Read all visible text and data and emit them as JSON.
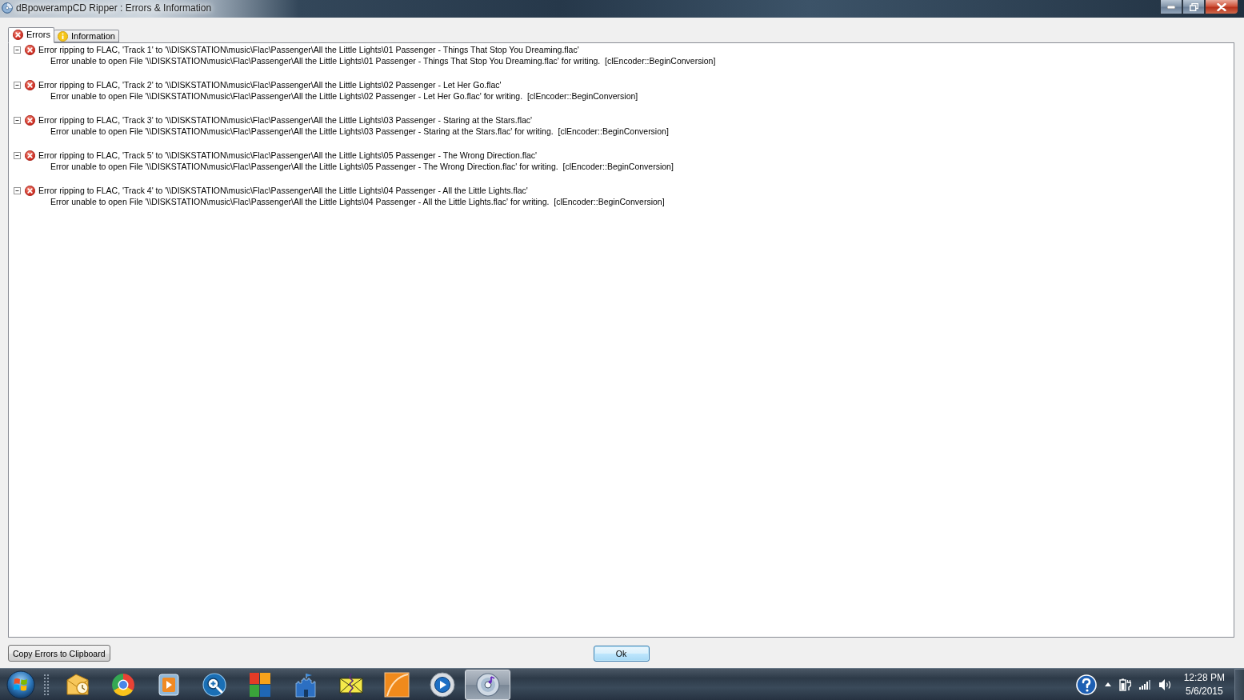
{
  "window": {
    "title": "dBpowerampCD Ripper : Errors & Information"
  },
  "tabs": [
    {
      "label": "Errors",
      "kind": "error",
      "selected": true
    },
    {
      "label": "Information",
      "kind": "info",
      "selected": false
    }
  ],
  "log": {
    "entries": [
      {
        "text": "Error ripping to FLAC, 'Track 1' to '\\\\DISKSTATION\\music\\Flac\\Passenger\\All the Little Lights\\01 Passenger - Things That Stop You Dreaming.flac'",
        "expanded": true,
        "children": [
          {
            "text": "Error unable to open File '\\\\DISKSTATION\\music\\Flac\\Passenger\\All the Little Lights\\01 Passenger - Things That Stop You Dreaming.flac' for writing.  [clEncoder::BeginConversion]"
          }
        ]
      },
      {
        "text": "Error ripping to FLAC, 'Track 2' to '\\\\DISKSTATION\\music\\Flac\\Passenger\\All the Little Lights\\02 Passenger - Let Her Go.flac'",
        "expanded": true,
        "children": [
          {
            "text": "Error unable to open File '\\\\DISKSTATION\\music\\Flac\\Passenger\\All the Little Lights\\02 Passenger - Let Her Go.flac' for writing.  [clEncoder::BeginConversion]"
          }
        ]
      },
      {
        "text": "Error ripping to FLAC, 'Track 3' to '\\\\DISKSTATION\\music\\Flac\\Passenger\\All the Little Lights\\03 Passenger - Staring at the Stars.flac'",
        "expanded": true,
        "children": [
          {
            "text": "Error unable to open File '\\\\DISKSTATION\\music\\Flac\\Passenger\\All the Little Lights\\03 Passenger - Staring at the Stars.flac' for writing.  [clEncoder::BeginConversion]"
          }
        ]
      },
      {
        "text": "Error ripping to FLAC, 'Track 5' to '\\\\DISKSTATION\\music\\Flac\\Passenger\\All the Little Lights\\05 Passenger - The Wrong Direction.flac'",
        "expanded": true,
        "children": [
          {
            "text": "Error unable to open File '\\\\DISKSTATION\\music\\Flac\\Passenger\\All the Little Lights\\05 Passenger - The Wrong Direction.flac' for writing.  [clEncoder::BeginConversion]"
          }
        ]
      },
      {
        "text": "Error ripping to FLAC, 'Track 4' to '\\\\DISKSTATION\\music\\Flac\\Passenger\\All the Little Lights\\04 Passenger - All the Little Lights.flac'",
        "expanded": true,
        "children": [
          {
            "text": "Error unable to open File '\\\\DISKSTATION\\music\\Flac\\Passenger\\All the Little Lights\\04 Passenger - All the Little Lights.flac' for writing.  [clEncoder::BeginConversion]"
          }
        ]
      }
    ]
  },
  "copy_button": {
    "label": "Copy Errors to Clipboard"
  },
  "ok_button": {
    "label": "Ok",
    "focused": true
  },
  "taskbar": {
    "apps": [
      {
        "selected": false
      },
      {
        "selected": false
      },
      {
        "selected": false
      },
      {
        "selected": false
      },
      {
        "selected": false
      },
      {
        "selected": false
      },
      {
        "selected": false
      },
      {
        "selected": false
      },
      {
        "selected": false
      },
      {
        "selected": true
      }
    ],
    "clock": {
      "time": "12:28 PM",
      "date": "5/6/2015"
    }
  }
}
